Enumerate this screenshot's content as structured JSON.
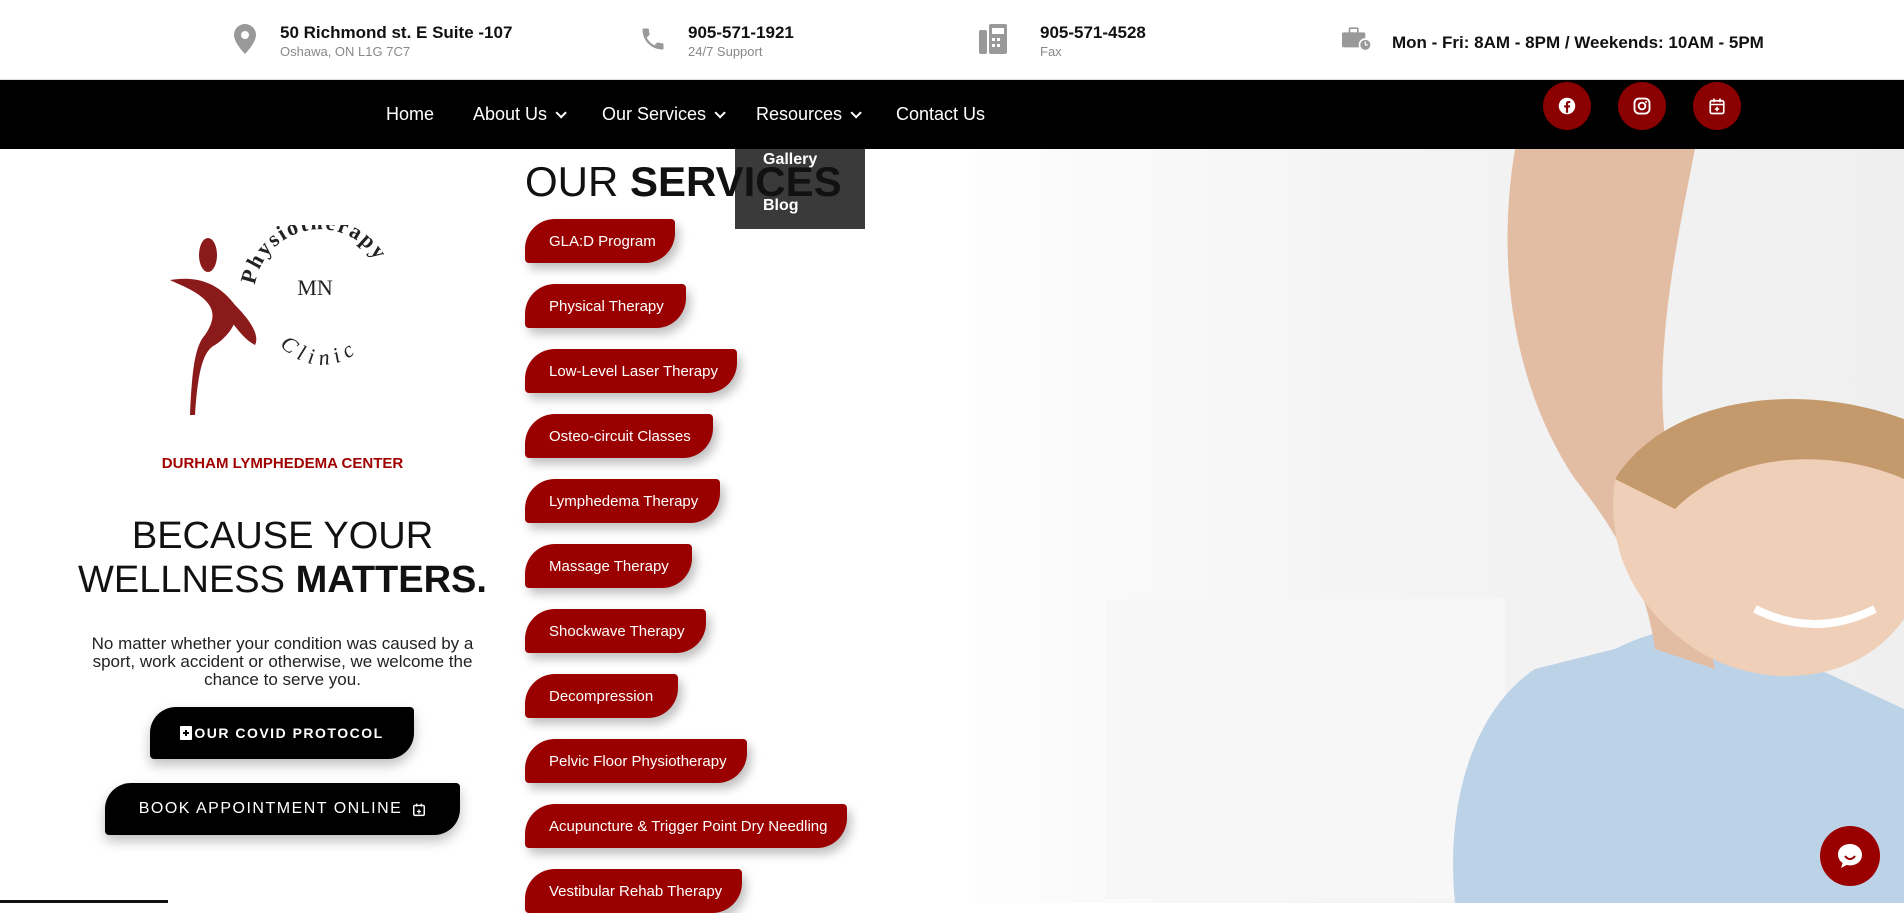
{
  "topbar": {
    "address": {
      "line1": "50 Richmond st. E Suite -107",
      "line2": "Oshawa, ON L1G 7C7",
      "icon": "map-pin-icon"
    },
    "phone": {
      "line1": "905-571-1921",
      "line2": "24/7 Support",
      "icon": "phone-icon"
    },
    "fax": {
      "line1": "905-571-4528",
      "line2": "Fax",
      "icon": "fax-icon"
    },
    "hours": {
      "line1": "Mon - Fri: 8AM - 8PM / Weekends: 10AM - 5PM",
      "icon": "briefcase-clock-icon"
    }
  },
  "nav": {
    "home": "Home",
    "about": "About Us",
    "services": "Our Services",
    "resources": "Resources",
    "contact": "Contact Us"
  },
  "social": [
    "facebook-icon",
    "instagram-icon",
    "calendar-icon"
  ],
  "dropdown": {
    "gallery": "Gallery",
    "blog": "Blog"
  },
  "hero": {
    "logo_text": {
      "physio": "Physiotherapy",
      "mn": "MN",
      "clinic": "Clinic"
    },
    "center_name": "DURHAM LYMPHEDEMA CENTER",
    "tagline_line1": "BECAUSE YOUR",
    "tagline_line2_light": "WELLNESS ",
    "tagline_line2_bold": "MATTERS.",
    "description": "No matter whether your condition was caused by a sport, work accident or otherwise, we welcome the chance to serve you.",
    "covid_button": "OUR COVID PROTOCOL",
    "book_button": "BOOK APPOINTMENT ONLINE"
  },
  "services": {
    "title_light": "OUR ",
    "title_bold": "SERVICES",
    "items": [
      "GLA:D Program",
      "Physical Therapy",
      "Low-Level Laser Therapy",
      "Osteo-circuit Classes",
      "Lymphedema Therapy",
      "Massage Therapy",
      "Shockwave Therapy",
      "Decompression",
      "Pelvic Floor Physiotherapy",
      "Acupuncture & Trigger Point Dry Needling",
      "Vestibular Rehab Therapy"
    ]
  },
  "colors": {
    "brand_red": "#9a0000",
    "nav_bg": "#000000",
    "dropdown_bg": "#3a3a3a"
  }
}
